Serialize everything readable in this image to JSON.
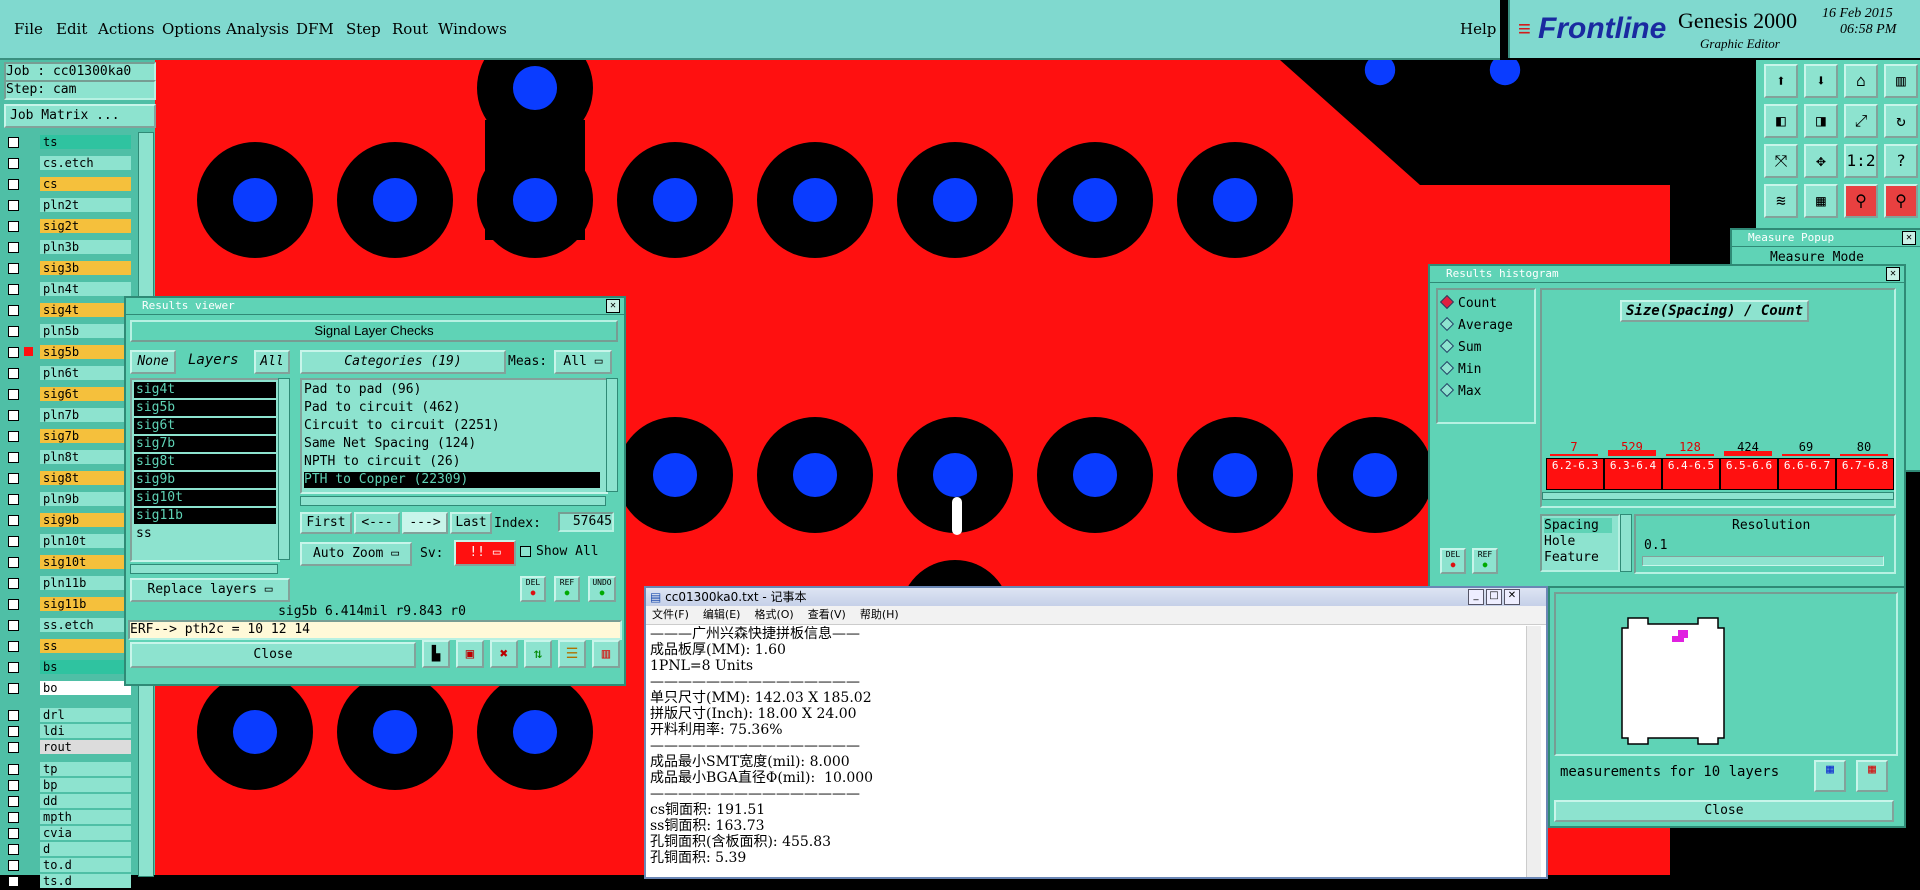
{
  "menubar": {
    "items": [
      "File",
      "Edit",
      "Actions",
      "Options",
      "Analysis",
      "DFM",
      "Step",
      "Rout",
      "Windows"
    ],
    "help": "Help"
  },
  "brand": {
    "logo": "Frontline",
    "product": "Genesis 2000",
    "subtitle": "Graphic Editor",
    "date": "16 Feb 2015",
    "time": "06:58 PM"
  },
  "left": {
    "job": "Job : cc01300ka0",
    "step": "Step: cam",
    "job_matrix": "Job Matrix ...",
    "layers": [
      {
        "name": "ts",
        "color": "#2fc3a0"
      },
      {
        "name": "cs.etch",
        "color": "#8de3cf"
      },
      {
        "name": "cs",
        "color": "#f5c03c"
      },
      {
        "name": "pln2t",
        "color": "#8de3cf"
      },
      {
        "name": "sig2t",
        "color": "#f5c03c"
      },
      {
        "name": "pln3b",
        "color": "#8de3cf"
      },
      {
        "name": "sig3b",
        "color": "#f5c03c"
      },
      {
        "name": "pln4t",
        "color": "#8de3cf"
      },
      {
        "name": "sig4t",
        "color": "#f5c03c"
      },
      {
        "name": "pln5b",
        "color": "#8de3cf"
      },
      {
        "name": "sig5b",
        "color": "#f5c03c"
      },
      {
        "name": "pln6t",
        "color": "#8de3cf"
      },
      {
        "name": "sig6t",
        "color": "#f5c03c"
      },
      {
        "name": "pln7b",
        "color": "#8de3cf"
      },
      {
        "name": "sig7b",
        "color": "#f5c03c"
      },
      {
        "name": "pln8t",
        "color": "#8de3cf"
      },
      {
        "name": "sig8t",
        "color": "#f5c03c"
      },
      {
        "name": "pln9b",
        "color": "#8de3cf"
      },
      {
        "name": "sig9b",
        "color": "#f5c03c"
      },
      {
        "name": "pln10t",
        "color": "#8de3cf"
      },
      {
        "name": "sig10t",
        "color": "#f5c03c"
      },
      {
        "name": "pln11b",
        "color": "#8de3cf"
      },
      {
        "name": "sig11b",
        "color": "#f5c03c"
      },
      {
        "name": "ss.etch",
        "color": "#8de3cf"
      },
      {
        "name": "ss",
        "color": "#f5c03c"
      },
      {
        "name": "bs",
        "color": "#2fc3a0"
      },
      {
        "name": "bo",
        "color": "#ffffff"
      }
    ],
    "drill_layers": [
      {
        "name": "drl",
        "color": "#8de3cf"
      },
      {
        "name": "ldi",
        "color": "#8de3cf"
      },
      {
        "name": "rout",
        "color": "#dcdcdc"
      }
    ],
    "misc_layers": [
      "tp",
      "bp",
      "dd",
      "mpth",
      "cvia",
      "d",
      "to.d",
      "ts.d"
    ]
  },
  "results_viewer": {
    "title": "Results viewer",
    "header": "Signal Layer Checks",
    "none": "None",
    "layers": "Layers",
    "all": "All",
    "categories": "Categories (19)",
    "meas_label": "Meas:",
    "meas_value": "All",
    "layer_list": [
      "sig4t",
      "sig5b",
      "sig6t",
      "sig7b",
      "sig8t",
      "sig9b",
      "sig10t",
      "sig11b",
      "ss"
    ],
    "category_list": [
      "Pad to pad (96)",
      "Pad to circuit (462)",
      "Circuit to circuit (2251)",
      "Same Net Spacing (124)",
      "NPTH to circuit (26)",
      "PTH to Copper (22309)"
    ],
    "first": "First",
    "prev": "<---",
    "next": "--->",
    "last": "Last",
    "index_label": "Index:",
    "index_value": "57645",
    "auto_zoom": "Auto Zoom",
    "sv": "Sv:",
    "sv_value": "!!",
    "show_all": "Show All",
    "replace_layers": "Replace layers",
    "del": "DEL",
    "ref": "REF",
    "undo": "UNDO",
    "status": "sig5b 6.414mil  r9.843  r0",
    "erf": "ERF--> pth2c = 10 12 14",
    "close": "Close"
  },
  "histogram": {
    "title": "Results histogram",
    "modes": [
      "Count",
      "Average",
      "Sum",
      "Min",
      "Max"
    ],
    "chart_title": "Size(Spacing) / Count",
    "counts": [
      "7",
      "529",
      "128",
      "424",
      "69",
      "80"
    ],
    "bins": [
      "6.2-6.3",
      "6.3-6.4",
      "6.4-6.5",
      "6.5-6.6",
      "6.6-6.7",
      "6.7-6.8"
    ],
    "types": [
      "Spacing",
      "Hole",
      "Feature"
    ],
    "resolution_label": "Resolution",
    "resolution_value": "0.1",
    "del": "DEL",
    "ref": "REF"
  },
  "measure_popup": {
    "title": "Measure Popup",
    "mode": "Measure Mode"
  },
  "summary": {
    "measurements": "measurements for 10 layers",
    "close": "Close"
  },
  "notepad": {
    "title": "cc01300ka0.txt - 记事本",
    "menus": [
      "文件(F)",
      "编辑(E)",
      "格式(O)",
      "查看(V)",
      "帮助(H)"
    ],
    "lines": [
      "———广州兴森快捷拼板信息——",
      "成品板厚(MM): 1.60",
      "1PNL=8 Units",
      "———————————————",
      "单只尺寸(MM): 142.03 X 185.02",
      "拼版尺寸(Inch): 18.00 X 24.00",
      "开料利用率: 75.36%",
      "———————————————",
      "成品最小SMT宽度(mil): 8.000",
      "成品最小BGA直径Φ(mil):  10.000",
      "———————————————",
      "cs铜面积: 191.51",
      "ss铜面积: 163.73",
      "孔铜面积(含板面积): 455.83",
      "孔铜面积: 5.39"
    ]
  }
}
